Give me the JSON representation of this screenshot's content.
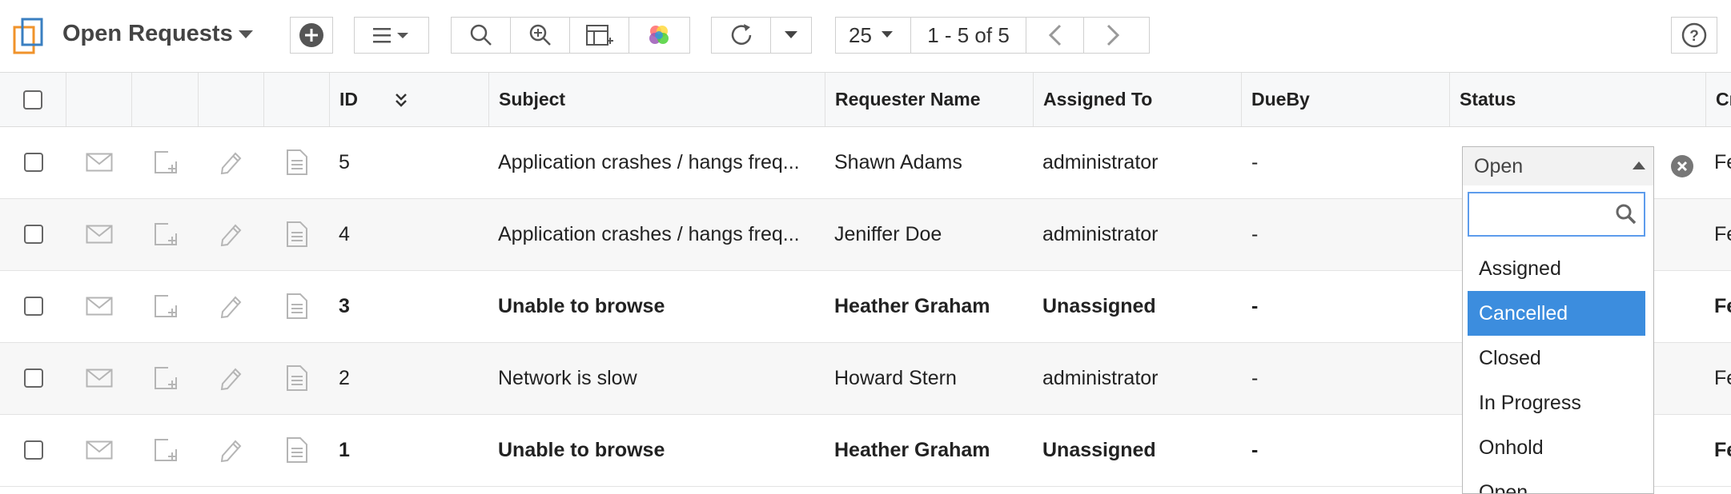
{
  "toolbar": {
    "view_title": "Open Requests",
    "per_page": "25",
    "pagination": "1 - 5 of 5"
  },
  "columns": {
    "id": "ID",
    "subject": "Subject",
    "requester": "Requester Name",
    "assigned": "Assigned To",
    "dueby": "DueBy",
    "status": "Status",
    "created_partial": "Cr"
  },
  "rows": [
    {
      "id": "5",
      "subject": "Application crashes / hangs freq...",
      "requester": "Shawn Adams",
      "assigned": "administrator",
      "dueby": "-",
      "created_partial": "Fe",
      "bold": false
    },
    {
      "id": "4",
      "subject": "Application crashes / hangs freq...",
      "requester": "Jeniffer Doe",
      "assigned": "administrator",
      "dueby": "-",
      "created_partial": "Fe",
      "bold": false
    },
    {
      "id": "3",
      "subject": "Unable to browse",
      "requester": "Heather Graham",
      "assigned": "Unassigned",
      "dueby": "-",
      "created_partial": "Fe",
      "bold": true
    },
    {
      "id": "2",
      "subject": "Network is slow",
      "requester": "Howard Stern",
      "assigned": "administrator",
      "dueby": "-",
      "created_partial": "Fe",
      "bold": false
    },
    {
      "id": "1",
      "subject": "Unable to browse",
      "requester": "Heather Graham",
      "assigned": "Unassigned",
      "dueby": "-",
      "created_partial": "Fe",
      "bold": true
    }
  ],
  "status_dropdown": {
    "selected": "Open",
    "search_value": "",
    "options": [
      "Assigned",
      "Cancelled",
      "Closed",
      "In Progress",
      "Onhold",
      "Open"
    ],
    "highlighted": "Cancelled"
  },
  "colors": {
    "accent": "#3c8dde",
    "logo_orange": "#f0932b",
    "logo_blue": "#3a7fc1"
  },
  "icons": [
    "logo-icon",
    "add-icon",
    "menu-icon",
    "search-icon",
    "zoom-icon",
    "table-columns-icon",
    "color-palette-icon",
    "refresh-icon",
    "prev-icon",
    "next-icon",
    "help-icon",
    "mail-icon",
    "add-note-icon",
    "edit-icon",
    "document-icon",
    "clear-icon"
  ]
}
